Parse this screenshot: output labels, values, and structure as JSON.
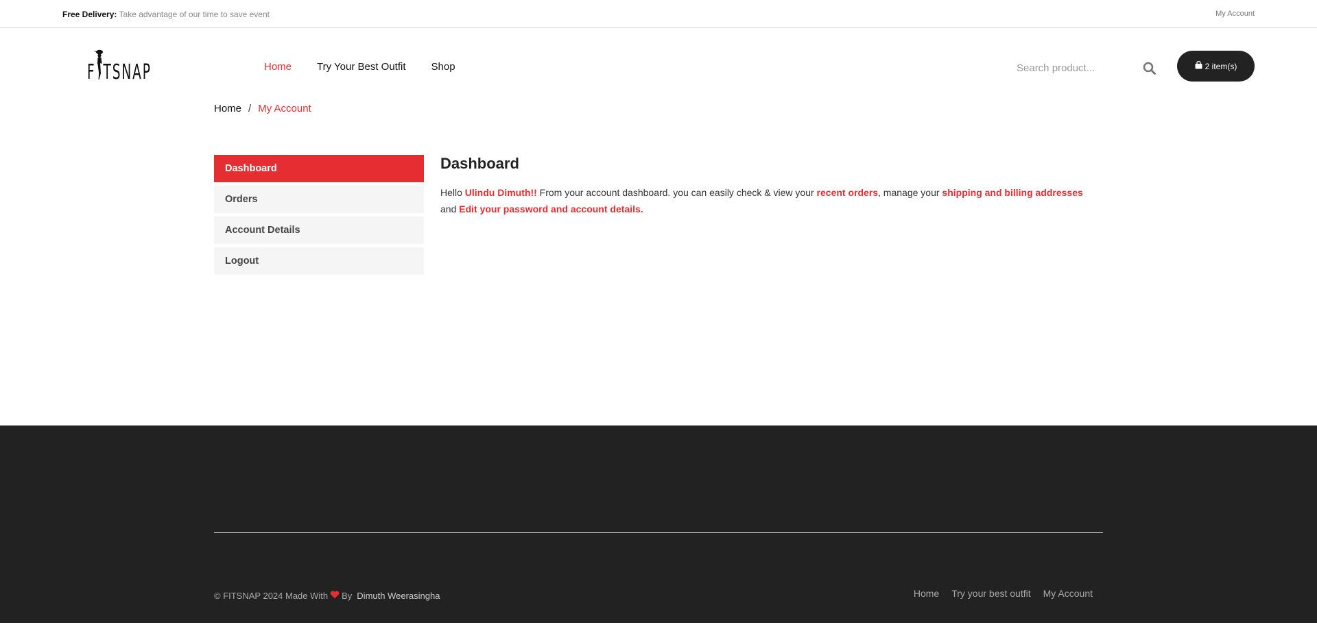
{
  "topbar": {
    "promo_label": "Free Delivery:",
    "promo_text": "Take advantage of our time to save event",
    "account_link": "My Account"
  },
  "header": {
    "logo_text": "FITSNAP",
    "nav": [
      "Home",
      "Try Your Best Outfit",
      "Shop"
    ],
    "search_placeholder": "Search product...",
    "cart_label": "2 item(s)",
    "icons": {
      "search": "search-icon",
      "cart": "shopping-bag-icon",
      "logo": "fitsnap-logo"
    }
  },
  "breadcrumb": {
    "home": "Home",
    "separator": "/",
    "current": "My Account"
  },
  "sidebar": {
    "items": [
      {
        "label": "Dashboard",
        "active": true
      },
      {
        "label": "Orders",
        "active": false
      },
      {
        "label": "Account Details",
        "active": false
      },
      {
        "label": "Logout",
        "active": false
      }
    ]
  },
  "dashboard": {
    "title": "Dashboard",
    "hello": "Hello",
    "user_name": "Ulindu Dimuth!!",
    "text_1": "From your account dashboard. you can easily check & view your",
    "recent_orders_link": "recent orders",
    "text_2": ", manage your",
    "addresses_link": "shipping and billing addresses",
    "text_3": "and",
    "account_details_link": "Edit your password and account details."
  },
  "footer": {
    "copyright_prefix": "© FITSNAP 2024 Made With",
    "by": "By",
    "author": "Dimuth Weerasingha",
    "links": [
      "Home",
      "Try your best outfit",
      "My Account"
    ],
    "icons": {
      "heart": "heart-icon"
    }
  },
  "colors": {
    "accent": "#e52e32",
    "dark": "#222222",
    "sidebar_bg": "#f5f5f5"
  }
}
